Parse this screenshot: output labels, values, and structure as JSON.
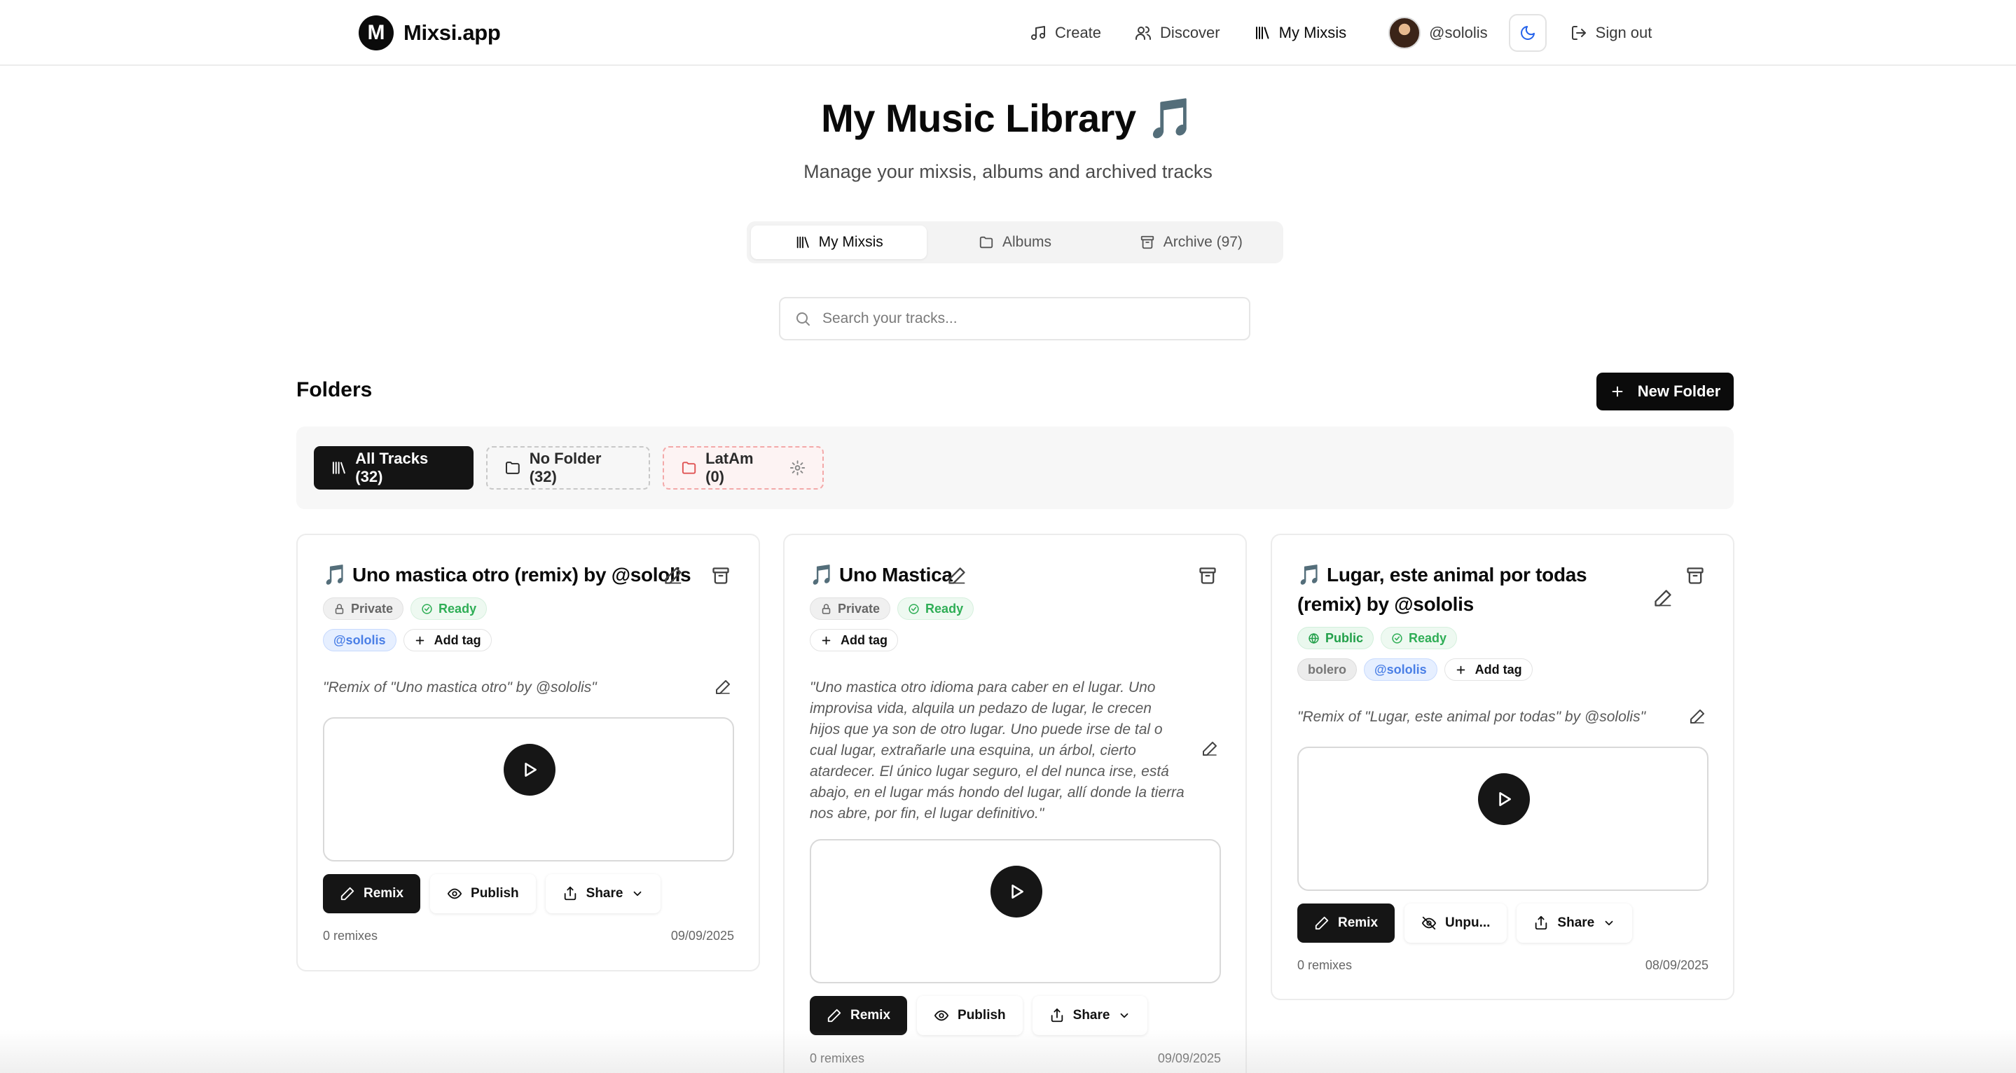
{
  "nav": {
    "brand_initial": "M",
    "brand_name": "Mixsi.app",
    "links": [
      {
        "label": "Create",
        "icon": "music-note-icon"
      },
      {
        "label": "Discover",
        "icon": "users-icon"
      },
      {
        "label": "My Mixsis",
        "icon": "library-icon"
      }
    ],
    "username": "@sololis",
    "theme_icon": "moon-icon",
    "signout_label": "Sign out"
  },
  "header": {
    "title": "My Music Library 🎵",
    "subtitle": "Manage your mixsis, albums and archived tracks"
  },
  "tabs": [
    {
      "label": "My Mixsis",
      "icon": "library-icon",
      "active": true
    },
    {
      "label": "Albums",
      "icon": "folder-icon",
      "active": false
    },
    {
      "label": "Archive (97)",
      "icon": "archive-icon",
      "active": false
    }
  ],
  "search": {
    "placeholder": "Search your tracks..."
  },
  "folders": {
    "title": "Folders",
    "new_folder_label": "New Folder",
    "chips": [
      {
        "label": "All Tracks (32)"
      },
      {
        "label": "No Folder (32)"
      },
      {
        "label": "LatAm (0)"
      }
    ]
  },
  "cards": [
    {
      "title": "🎵 Uno mastica otro (remix) by @sololis",
      "visibility": "Private",
      "status": "Ready",
      "tags": [
        "@sololis"
      ],
      "add_tag_label": "Add tag",
      "description": "\"Remix of \"Uno mastica otro\" by @sololis\"",
      "remix_label": "Remix",
      "publish_label": "Publish",
      "share_label": "Share",
      "remixes": "0 remixes",
      "date": "09/09/2025"
    },
    {
      "title": "🎵 Uno Mastica",
      "visibility": "Private",
      "status": "Ready",
      "tags": [],
      "add_tag_label": "Add tag",
      "description": "\"Uno mastica otro idioma para caber en el lugar. Uno improvisa vida, alquila un pedazo de lugar, le crecen hijos que ya son de otro lugar. Uno puede irse de tal o cual lugar, extrañarle una esquina, un árbol, cierto atardecer. El único lugar seguro, el del nunca irse, está abajo, en el lugar más hondo del lugar, allí donde la tierra nos abre, por fin, el lugar definitivo.\"",
      "remix_label": "Remix",
      "publish_label": "Publish",
      "share_label": "Share",
      "remixes": "0 remixes",
      "date": "09/09/2025"
    },
    {
      "title": "🎵 Lugar, este animal por todas (remix) by @sololis",
      "visibility": "Public",
      "status": "Ready",
      "tags": [
        "bolero",
        "@sololis"
      ],
      "add_tag_label": "Add tag",
      "description": "\"Remix of \"Lugar, este animal por todas\" by @sololis\"",
      "remix_label": "Remix",
      "publish_label": "Unpu...",
      "share_label": "Share",
      "remixes": "0 remixes",
      "date": "08/09/2025"
    }
  ]
}
